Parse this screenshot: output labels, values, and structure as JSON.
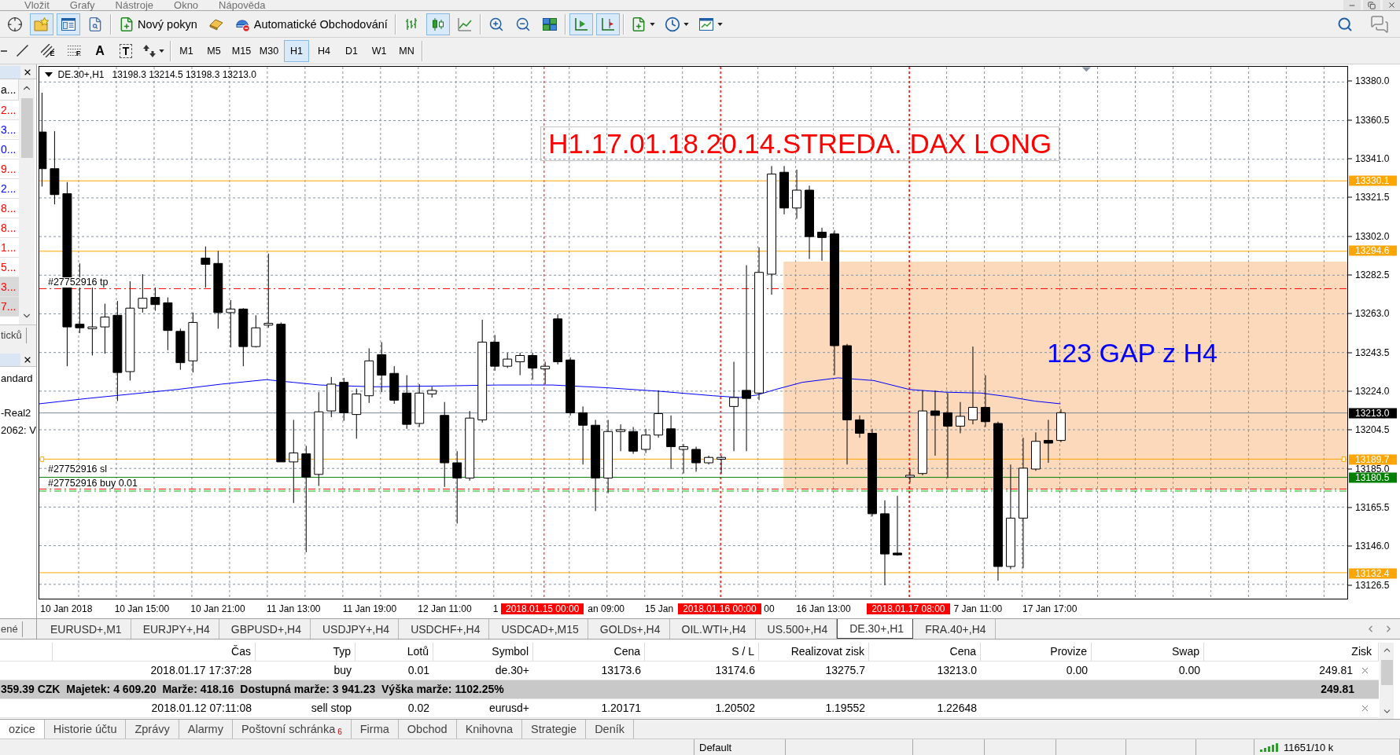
{
  "menu_bar": {
    "items": [
      "Vložit",
      "Grafy",
      "Nástroje",
      "Okno",
      "Nápověda"
    ]
  },
  "toolbar": {
    "groups": [
      [
        {
          "kind": "crosshair",
          "selected": false
        },
        {
          "kind": "market_watch",
          "selected": true
        },
        {
          "kind": "navigator",
          "selected": true
        },
        {
          "kind": "tester",
          "selected": false
        }
      ],
      [
        {
          "kind": "new_order",
          "label": "Nový pokyn",
          "selected": false
        },
        {
          "kind": "editor",
          "selected": false
        },
        {
          "kind": "autotrading",
          "label": "Automatické Obchodování",
          "selected": false
        }
      ],
      [
        {
          "kind": "bar_chart",
          "selected": false
        },
        {
          "kind": "candles",
          "selected": true
        },
        {
          "kind": "line_chart",
          "selected": false
        }
      ],
      [
        {
          "kind": "zoom_in",
          "selected": false
        },
        {
          "kind": "zoom_out",
          "selected": false
        },
        {
          "kind": "tile",
          "selected": false
        }
      ],
      [
        {
          "kind": "autoscroll",
          "selected": true
        },
        {
          "kind": "chart_shift",
          "selected": true
        }
      ],
      [
        {
          "kind": "indicators",
          "selected": false
        },
        {
          "kind": "periods",
          "selected": false
        },
        {
          "kind": "templates",
          "selected": false
        }
      ]
    ]
  },
  "drawing_toolbar": {
    "tools": [
      {
        "kind": "hline",
        "selected": false
      },
      {
        "kind": "trendline",
        "selected": false
      },
      {
        "kind": "channel",
        "letter": "E",
        "selected": false
      },
      {
        "kind": "fibo",
        "letter": "F",
        "selected": false
      },
      {
        "kind": "text",
        "letter": "A",
        "selected": false
      },
      {
        "kind": "label",
        "letter": "T",
        "selected": false
      },
      {
        "kind": "arrows",
        "selected": false
      }
    ],
    "periods": [
      {
        "label": "M1",
        "selected": false
      },
      {
        "label": "M5",
        "selected": false
      },
      {
        "label": "M15",
        "selected": false
      },
      {
        "label": "M30",
        "selected": false
      },
      {
        "label": "H1",
        "selected": true
      },
      {
        "label": "H4",
        "selected": false
      },
      {
        "label": "D1",
        "selected": false
      },
      {
        "label": "W1",
        "selected": false
      },
      {
        "label": "MN",
        "selected": false
      }
    ]
  },
  "market_watch": {
    "header": "a...",
    "rows": [
      {
        "text": "2...",
        "color": "#ff0000",
        "selected": false
      },
      {
        "text": "3...",
        "color": "#0000ff",
        "selected": false
      },
      {
        "text": "0...",
        "color": "#0000ff",
        "selected": false
      },
      {
        "text": "9...",
        "color": "#ff0000",
        "selected": false
      },
      {
        "text": "2...",
        "color": "#0000ff",
        "selected": false
      },
      {
        "text": "8...",
        "color": "#ff0000",
        "selected": false
      },
      {
        "text": "8...",
        "color": "#ff0000",
        "selected": false
      },
      {
        "text": "1...",
        "color": "#ff0000",
        "selected": false
      },
      {
        "text": "5...",
        "color": "#ff0000",
        "selected": false
      },
      {
        "text": "3...",
        "color": "#ff0000",
        "selected": true
      },
      {
        "text": "7...",
        "color": "#ff0000",
        "selected": true
      }
    ],
    "tab": "ticků"
  },
  "navigator": {
    "lines": [
      "andard",
      "-Real2",
      "2062: V"
    ],
    "tab": "ené"
  },
  "chart": {
    "header": {
      "symbol": "DE.30+,H1",
      "ohlc": "13198.3 13214.5 13198.3 13213.0"
    },
    "labels": [
      {
        "kind": "title",
        "text": "H1.17.01.18.20.14.STREDA. DAX LONG",
        "color": "#ff0000"
      },
      {
        "kind": "note",
        "text": "123 GAP z H4",
        "color": "#0000ff"
      }
    ],
    "order_labels": [
      {
        "kind": "tp",
        "text": "#27752916 tp"
      },
      {
        "kind": "sl",
        "text": "#27752916 sl"
      },
      {
        "kind": "entry",
        "text": "#27752916 buy 0.01"
      }
    ],
    "price_axis": {
      "ticks": [
        "13380.0",
        "13360.5",
        "13341.0",
        "13321.5",
        "13302.0",
        "13282.5",
        "13263.0",
        "13243.5",
        "13224.0",
        "13204.5",
        "13185.0",
        "13165.5",
        "13146.0",
        "13126.5"
      ],
      "tags": [
        {
          "text": "13330.1",
          "color": "#ffa500"
        },
        {
          "text": "13294.6",
          "color": "#ffa500"
        },
        {
          "text": "13213.0",
          "color": "#000000"
        },
        {
          "text": "13189.7",
          "color": "#ffa500"
        },
        {
          "text": "13180.5",
          "color": "#008000"
        },
        {
          "text": "13132.4",
          "color": "#ffa500"
        }
      ]
    },
    "time_axis": {
      "labels": [
        {
          "kind": "label",
          "text": "10 Jan 2018"
        },
        {
          "kind": "label",
          "text": "10 Jan 15:00"
        },
        {
          "kind": "label",
          "text": "10 Jan 21:00"
        },
        {
          "kind": "label",
          "text": "11 Jan 13:00"
        },
        {
          "kind": "label",
          "text": "11 Jan 19:00"
        },
        {
          "kind": "label",
          "text": "12 Jan 11:00"
        },
        {
          "kind": "label",
          "text": "1"
        },
        {
          "kind": "marker",
          "text": "2018.01.15 00:00"
        },
        {
          "kind": "label",
          "text": "an 09:00"
        },
        {
          "kind": "label",
          "text": "15 Jan"
        },
        {
          "kind": "marker",
          "text": "2018.01.16 00:00"
        },
        {
          "kind": "label",
          "text": "00"
        },
        {
          "kind": "label",
          "text": "16 Jan 13:00"
        },
        {
          "kind": "marker",
          "text": "2018.01.17 08:00"
        },
        {
          "kind": "label",
          "text": "7 Jan 11:00"
        },
        {
          "kind": "label",
          "text": "17 Jan 17:00"
        }
      ]
    }
  },
  "chart_tabs": [
    {
      "label": "EURUSD+,M1",
      "selected": false
    },
    {
      "label": "EURJPY+,H4",
      "selected": false
    },
    {
      "label": "GBPUSD+,H4",
      "selected": false
    },
    {
      "label": "USDJPY+,H4",
      "selected": false
    },
    {
      "label": "USDCHF+,H4",
      "selected": false
    },
    {
      "label": "USDCAD+,M15",
      "selected": false
    },
    {
      "label": "GOLDs+,H4",
      "selected": false
    },
    {
      "label": "OIL.WTI+,H4",
      "selected": false
    },
    {
      "label": "US.500+,H4",
      "selected": false
    },
    {
      "label": "DE.30+,H1",
      "selected": true
    },
    {
      "label": "FRA.40+,H4",
      "selected": false
    }
  ],
  "terminal": {
    "columns": [
      "Čas",
      "Typ",
      "Lotů",
      "Symbol",
      "Cena",
      "S / L",
      "Realizovat zisk",
      "Cena",
      "Provize",
      "Swap",
      "Zisk"
    ],
    "rows": [
      {
        "kind": "order",
        "cells": [
          "2018.01.17 17:37:28",
          "buy",
          "0.01",
          "de.30+",
          "13173.6",
          "13174.6",
          "13275.7",
          "13213.0",
          "0.00",
          "0.00",
          "249.81"
        ]
      },
      {
        "kind": "summary",
        "text": "359.39 CZK  Majetek: 4 609.20  Marže: 418.16  Dostupná marže: 3 941.23  Výška marže: 1102.25%",
        "total": "249.81"
      },
      {
        "kind": "order",
        "cells": [
          "2018.01.12 07:11:08",
          "sell stop",
          "0.02",
          "eurusd+",
          "1.20171",
          "1.20502",
          "1.19552",
          "1.22648"
        ]
      }
    ]
  },
  "terminal_tabs": [
    {
      "label": "ozice",
      "selected": true
    },
    {
      "label": "Historie účtu",
      "selected": false
    },
    {
      "label": "Zprávy",
      "selected": false
    },
    {
      "label": "Alarmy",
      "selected": false
    },
    {
      "label": "Poštovní schránka",
      "selected": false,
      "badge": "6"
    },
    {
      "label": "Firma",
      "selected": false
    },
    {
      "label": "Obchod",
      "selected": false
    },
    {
      "label": "Knihovna",
      "selected": false
    },
    {
      "label": "Strategie",
      "selected": false
    },
    {
      "label": "Deník",
      "selected": false
    }
  ],
  "status_bar": {
    "profile": "Default",
    "traffic": "11651/10 k"
  }
}
